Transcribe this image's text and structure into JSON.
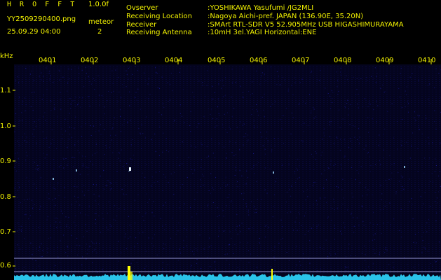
{
  "header": {
    "app_title": "H R O F F T",
    "version": "1.0.0f",
    "filename": "YY2509290400.png",
    "datetime": "25.09.29 04:00",
    "meteor_label": "meteor",
    "meteor_count": "2",
    "info": [
      {
        "key": "Ovserver",
        "value": ":YOSHIKAWA Yasufumi /JG2MLI"
      },
      {
        "key": "Receiving Location",
        "value": ":Nagoya Aichi-pref. JAPAN (136.90E, 35.20N)"
      },
      {
        "key": "Receiver",
        "value": ":SMArt RTL-SDR V5 52.905MHz USB HIGASHIMURAYAMA"
      },
      {
        "key": "Receiving Antenna",
        "value": ":10mH 3el.YAGI Horizontal:ENE"
      }
    ]
  },
  "time_labels": [
    "0401",
    "0402",
    "0403",
    "0404",
    "0405",
    "0406",
    "0407",
    "0408",
    "0409",
    "0410"
  ],
  "y_axis": {
    "unit": "kHz",
    "labels": [
      "1.1",
      "1.0",
      "0.9",
      "0.8",
      "0.7",
      "0.6"
    ]
  },
  "colors": {
    "text": "#f2f200",
    "background": "#000000",
    "grid": "#0d0d5a",
    "noise": "#1b1b9a",
    "signal": "#9ad6ff",
    "bottom_trace": "#2fd8ff",
    "marker": "#ffff00"
  }
}
